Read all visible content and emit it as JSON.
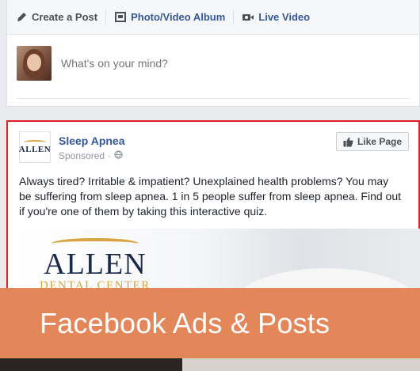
{
  "composer": {
    "tabs": [
      {
        "label": "Create a Post",
        "icon": "pencil-icon"
      },
      {
        "label": "Photo/Video Album",
        "icon": "photo-album-icon"
      },
      {
        "label": "Live Video",
        "icon": "video-camera-icon"
      }
    ],
    "placeholder": "What's on your mind?"
  },
  "ad": {
    "page_name": "Sleep Apnea",
    "sponsored": "Sponsored",
    "like_button": "Like Page",
    "text": "Always tired? Irritable & impatient? Unexplained health problems? You may be suffering from sleep apnea. 1 in 5 people suffer from sleep apnea. Find out if you're one of them by taking this interactive quiz.",
    "logo_small": "ALLEN",
    "image_logo_main": "ALLEN",
    "image_logo_sub": "DENTAL CENTER"
  },
  "banner": {
    "text": "Facebook Ads & Posts"
  },
  "colors": {
    "banner": "#e3865a",
    "ad_border": "#e41e26",
    "link": "#365899",
    "logo_navy": "#1b2a4a",
    "logo_gold": "#d9a441"
  }
}
